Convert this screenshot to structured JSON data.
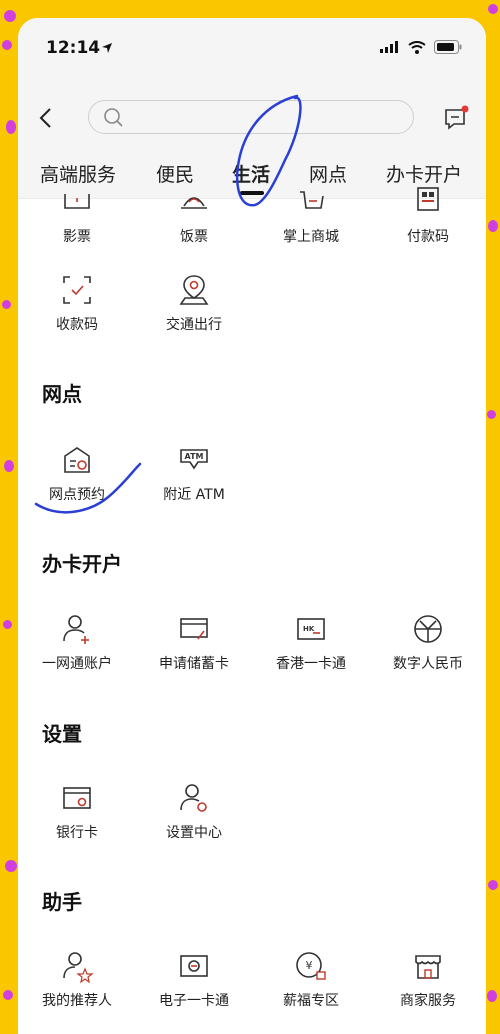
{
  "status": {
    "time": "12:14"
  },
  "tabs": [
    "高端服务",
    "便民",
    "生活",
    "网点",
    "办卡开户"
  ],
  "top_row": [
    "影票",
    "饭票",
    "掌上商城",
    "付款码"
  ],
  "row2": [
    "收款码",
    "交通出行"
  ],
  "sections": {
    "wangdian": {
      "title": "网点",
      "items": [
        "网点预约",
        "附近 ATM"
      ]
    },
    "banka": {
      "title": "办卡开户",
      "items": [
        "一网通账户",
        "申请储蓄卡",
        "香港一卡通",
        "数字人民币"
      ]
    },
    "shezhi": {
      "title": "设置",
      "items": [
        "银行卡",
        "设置中心"
      ]
    },
    "zhushou": {
      "title": "助手",
      "items": [
        "我的推荐人",
        "电子一卡通",
        "薪福专区",
        "商家服务"
      ]
    }
  },
  "icon_text": {
    "atm": "ATM",
    "hk": "HK",
    "yuan": "¥"
  }
}
